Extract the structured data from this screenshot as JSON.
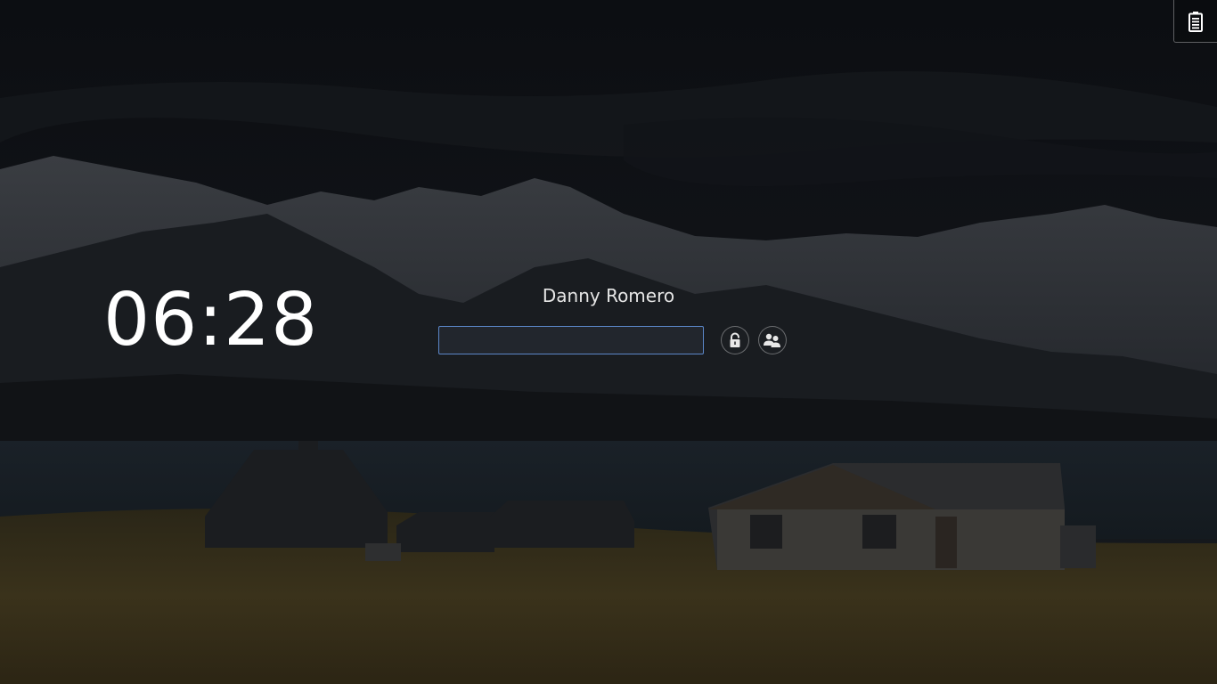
{
  "clock": {
    "time": "06:28"
  },
  "user": {
    "name": "Danny Romero"
  },
  "password_field": {
    "value": "",
    "placeholder": ""
  },
  "actions": {
    "unlock_icon": "lock-open-icon",
    "switch_user_icon": "users-icon"
  },
  "tray": {
    "icon": "battery-icon"
  },
  "colors": {
    "accent_border": "#5b86c8",
    "text": "#ffffff"
  }
}
